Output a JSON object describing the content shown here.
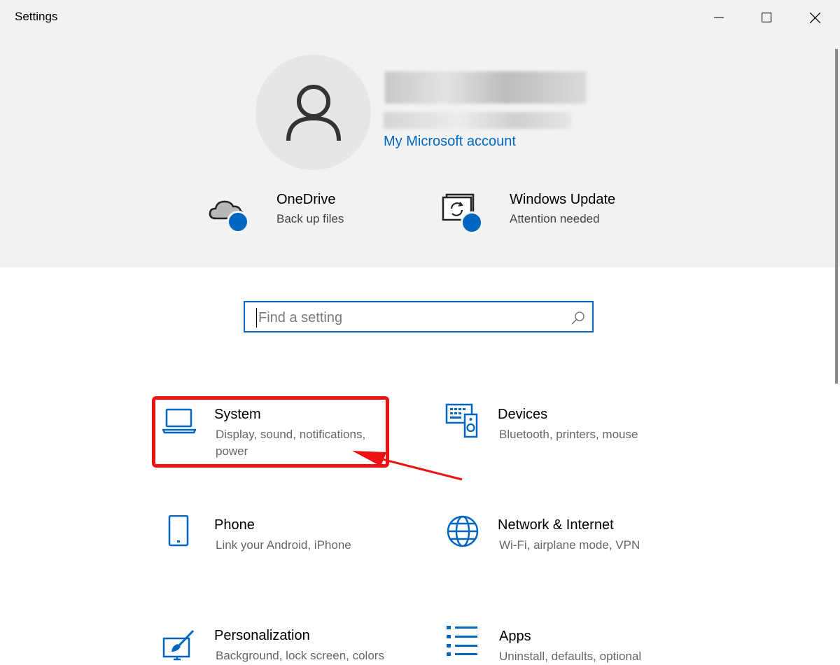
{
  "window": {
    "title": "Settings",
    "controls": [
      "minimize-icon",
      "maximize-icon",
      "close-icon"
    ]
  },
  "account": {
    "link_label": "My Microsoft account"
  },
  "quick": [
    {
      "title": "OneDrive",
      "subtitle": "Back up files",
      "icon": "onedrive-cloud-icon"
    },
    {
      "title": "Windows Update",
      "subtitle": "Attention needed",
      "icon": "windows-update-icon"
    }
  ],
  "search": {
    "placeholder": "Find a setting",
    "value": ""
  },
  "categories": [
    {
      "title": "System",
      "subtitle": "Display, sound, notifications, power",
      "icon": "laptop-icon"
    },
    {
      "title": "Devices",
      "subtitle": "Bluetooth, printers, mouse",
      "icon": "keyboard-speaker-icon"
    },
    {
      "title": "Phone",
      "subtitle": "Link your Android, iPhone",
      "icon": "phone-icon"
    },
    {
      "title": "Network & Internet",
      "subtitle": "Wi-Fi, airplane mode, VPN",
      "icon": "globe-icon"
    },
    {
      "title": "Personalization",
      "subtitle": "Background, lock screen, colors",
      "icon": "paint-brush-icon"
    },
    {
      "title": "Apps",
      "subtitle": "Uninstall, defaults, optional",
      "icon": "apps-list-icon"
    }
  ],
  "colors": {
    "accent": "#0067c0",
    "annotation": "#ee1111",
    "header_bg": "#f2f2f2"
  }
}
